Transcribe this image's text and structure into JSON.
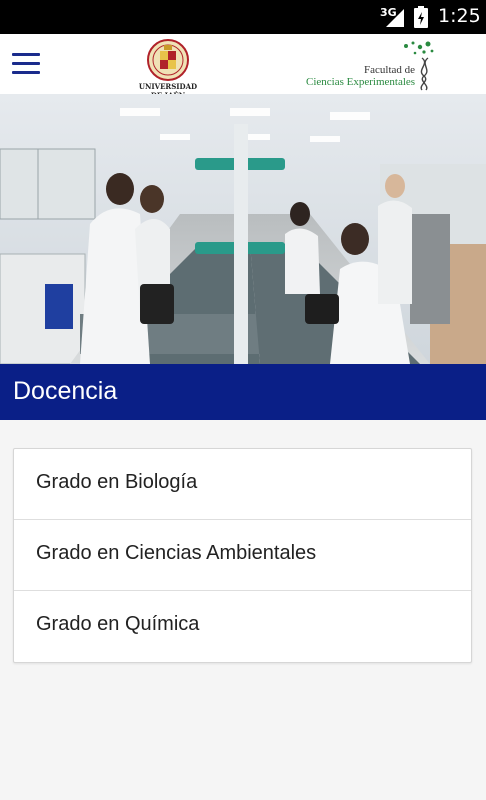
{
  "status_bar": {
    "network": "3G",
    "time": "1:25",
    "icons": [
      "signal-icon",
      "battery-icon"
    ]
  },
  "app_bar": {
    "menu_icon": "hamburger-menu-icon",
    "university_logo_text": "UNIVERSIDAD DE JAÉN",
    "faculty_logo_line1": "Facultad de",
    "faculty_logo_line2": "Ciencias Experimentales"
  },
  "hero": {
    "image": "laboratory-students-photo"
  },
  "section": {
    "title": "Docencia"
  },
  "degrees": [
    {
      "label": "Grado en Biología"
    },
    {
      "label": "Grado en Ciencias Ambientales"
    },
    {
      "label": "Grado en Química"
    }
  ],
  "colors": {
    "primary": "#0a1f87",
    "menu_icon": "#1a2b8c",
    "background": "#f5f5f5",
    "logo_green": "#2a8a40",
    "logo_red": "#b0222a"
  }
}
